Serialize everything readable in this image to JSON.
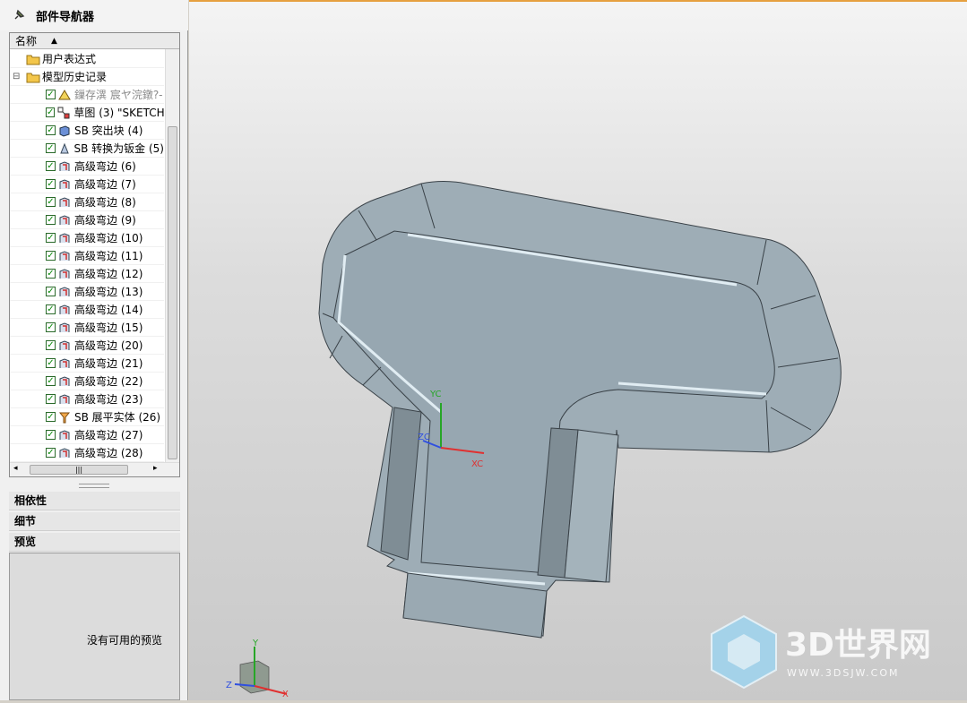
{
  "navigator": {
    "title": "部件导航器",
    "column_header": "名称",
    "items": [
      {
        "label": "用户表达式",
        "type": "folder",
        "checked": false
      },
      {
        "label": "模型历史记录",
        "type": "folder",
        "checked": false
      },
      {
        "label": "鏁存潩 宸ヤ浣鐓?-",
        "type": "datum",
        "checked": true
      },
      {
        "label": "草图 (3) \"SKETCH_",
        "type": "sketch",
        "checked": true
      },
      {
        "label": "SB 突出块 (4)",
        "type": "block",
        "checked": true
      },
      {
        "label": "SB 转换为钣金 (5)",
        "type": "convert",
        "checked": true
      },
      {
        "label": "高级弯边 (6)",
        "type": "flange",
        "checked": true
      },
      {
        "label": "高级弯边 (7)",
        "type": "flange",
        "checked": true
      },
      {
        "label": "高级弯边 (8)",
        "type": "flange",
        "checked": true
      },
      {
        "label": "高级弯边 (9)",
        "type": "flange",
        "checked": true
      },
      {
        "label": "高级弯边 (10)",
        "type": "flange",
        "checked": true
      },
      {
        "label": "高级弯边 (11)",
        "type": "flange",
        "checked": true
      },
      {
        "label": "高级弯边 (12)",
        "type": "flange",
        "checked": true
      },
      {
        "label": "高级弯边 (13)",
        "type": "flange",
        "checked": true
      },
      {
        "label": "高级弯边 (14)",
        "type": "flange",
        "checked": true
      },
      {
        "label": "高级弯边 (15)",
        "type": "flange",
        "checked": true
      },
      {
        "label": "高级弯边 (20)",
        "type": "flange",
        "checked": true
      },
      {
        "label": "高级弯边 (21)",
        "type": "flange",
        "checked": true
      },
      {
        "label": "高级弯边 (22)",
        "type": "flange",
        "checked": true
      },
      {
        "label": "高级弯边 (23)",
        "type": "flange",
        "checked": true
      },
      {
        "label": "SB 展平实体 (26)",
        "type": "flat",
        "checked": true
      },
      {
        "label": "高级弯边 (27)",
        "type": "flange",
        "checked": true
      },
      {
        "label": "高级弯边 (28)",
        "type": "flange",
        "checked": true
      }
    ]
  },
  "panels": {
    "dependencies": "相依性",
    "details": "细节",
    "preview": "预览",
    "preview_empty": "没有可用的预览"
  },
  "viewport": {
    "csys_labels": {
      "yc": "YC",
      "zc": "ZC",
      "xc": "XC"
    },
    "triad_labels": {
      "x": "X",
      "y": "Y",
      "z": "Z"
    }
  },
  "watermark": {
    "brand": "3D世界网",
    "url": "WWW.3DSJW.COM"
  },
  "colors": {
    "part_fill": "#9eadb6",
    "part_edge": "#3a4248",
    "check": "#0a8a0a",
    "accent": "#e6a040"
  }
}
